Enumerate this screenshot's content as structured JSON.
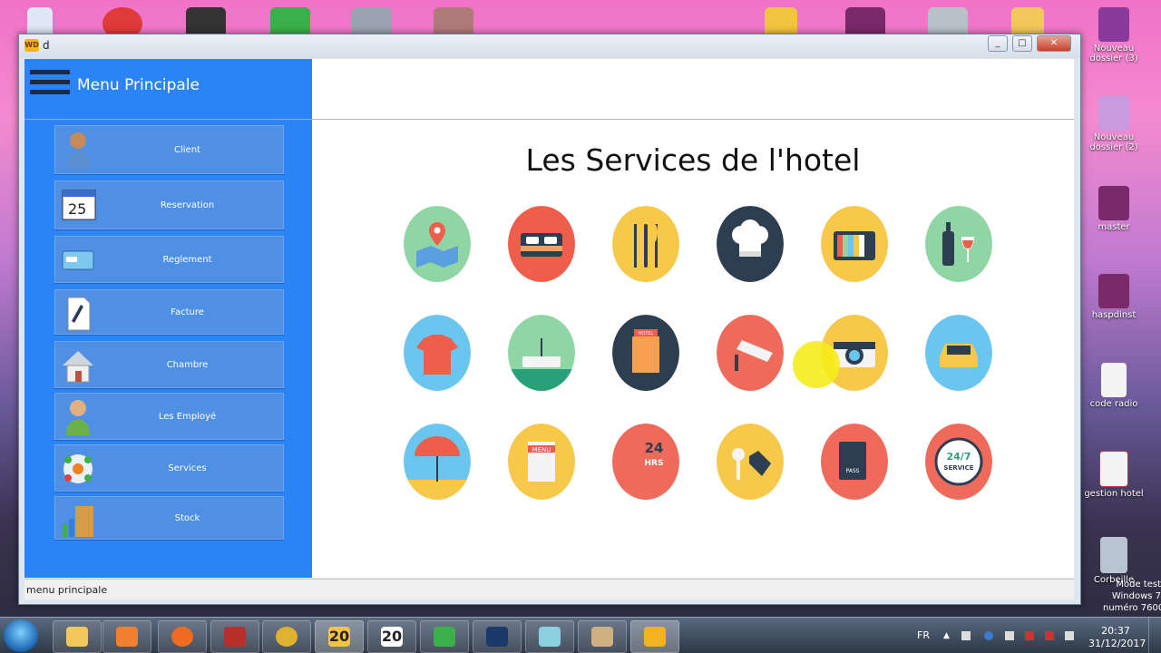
{
  "window": {
    "title": "d",
    "min": "_",
    "max": "□",
    "close": "✕"
  },
  "sidebar": {
    "title": "Menu Principale",
    "items": [
      {
        "label": "Client",
        "icon": "person-icon"
      },
      {
        "label": "Reservation",
        "icon": "calendar-icon"
      },
      {
        "label": "Reglement",
        "icon": "payment-card-icon"
      },
      {
        "label": "Facture",
        "icon": "document-pen-icon"
      },
      {
        "label": "Chambre",
        "icon": "house-icon"
      },
      {
        "label": "Les Employé",
        "icon": "employee-icon"
      },
      {
        "label": "Services",
        "icon": "network-icon"
      },
      {
        "label": "Stock",
        "icon": "stock-boxes-icon"
      }
    ],
    "calendar_day": "25"
  },
  "main": {
    "title": "Les Services de l'hotel",
    "services": [
      {
        "name": "map-location-icon",
        "bg": "#8fd6a4"
      },
      {
        "name": "bed-icon",
        "bg": "#ef5e4a"
      },
      {
        "name": "restaurant-cutlery-icon",
        "bg": "#f7c84a"
      },
      {
        "name": "chef-hat-icon",
        "bg": "#2d3e50"
      },
      {
        "name": "television-icon",
        "bg": "#f7c84a"
      },
      {
        "name": "wine-bar-icon",
        "bg": "#8fd6a4"
      },
      {
        "name": "laundry-shirt-icon",
        "bg": "#6bc6ef"
      },
      {
        "name": "wifi-router-icon",
        "bg": "#8fd6a4"
      },
      {
        "name": "hotel-building-icon",
        "bg": "#2d3e50"
      },
      {
        "name": "security-camera-icon",
        "bg": "#ef6a5a"
      },
      {
        "name": "camera-icon",
        "bg": "#f7c84a"
      },
      {
        "name": "taxi-icon",
        "bg": "#6bc6ef"
      },
      {
        "name": "beach-umbrella-icon",
        "bg": "#6bc6ef"
      },
      {
        "name": "menu-card-icon",
        "bg": "#f7c84a"
      },
      {
        "name": "phone-24hrs-icon",
        "bg": "#ef6a5a"
      },
      {
        "name": "key-tag-icon",
        "bg": "#f7c84a"
      },
      {
        "name": "passport-icon",
        "bg": "#ef6a5a"
      },
      {
        "name": "service-24-7-icon",
        "bg": "#ef6a5a"
      }
    ],
    "menu_text": "MENU",
    "hotel_text": "HOTEL",
    "hrs_24": "24",
    "hrs_label": "HRS",
    "pass_text": "PASS",
    "s247": "24/7",
    "service_text": "SERVICE"
  },
  "statusbar": {
    "text": "menu principale"
  },
  "desktop": {
    "icons": [
      {
        "label": "Nouveau dossier (3)"
      },
      {
        "label": "Nouveau dossier (2)"
      },
      {
        "label": "master"
      },
      {
        "label": "haspdinst"
      },
      {
        "label": "code radio"
      },
      {
        "label": "gestion hotel"
      },
      {
        "label": "Corbeille"
      }
    ],
    "watermark": [
      "Mode test",
      "Windows 7",
      "numéro 7600"
    ]
  },
  "taskbar": {
    "lang": "FR",
    "time": "20:37",
    "date": "31/12/2017",
    "ws20": "20"
  }
}
